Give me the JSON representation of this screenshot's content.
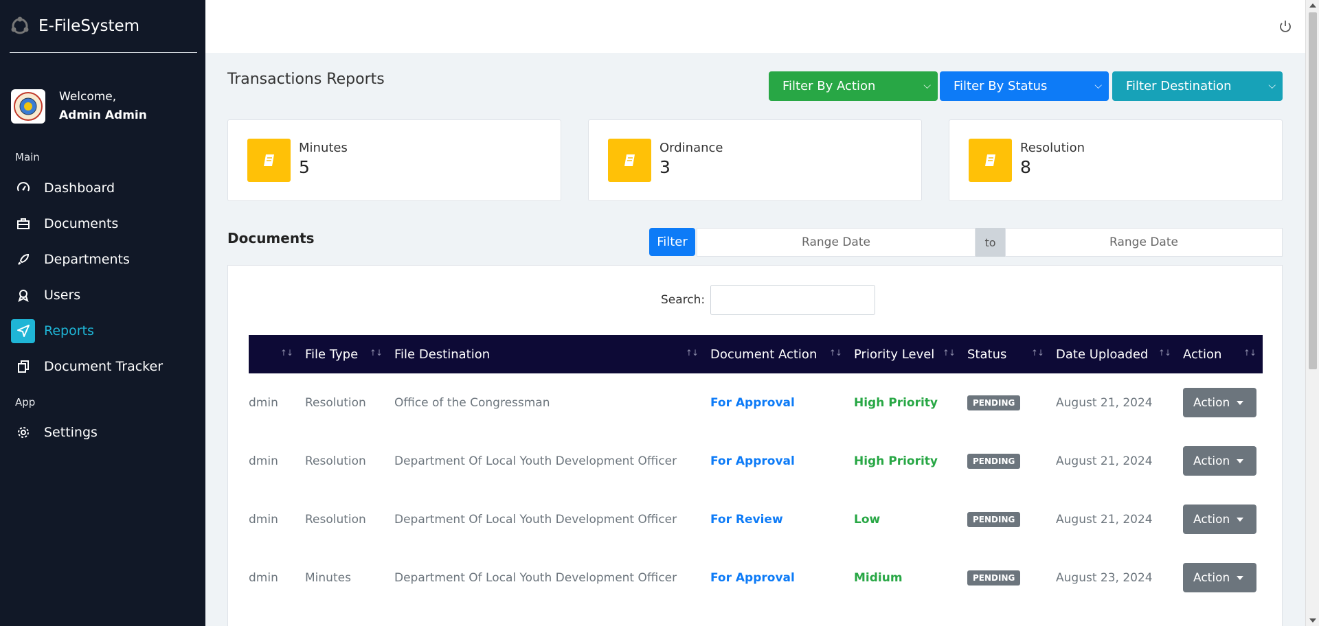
{
  "app": {
    "name": "E-FileSystem"
  },
  "user": {
    "greeting": "Welcome,",
    "name": "Admin Admin"
  },
  "sidebar": {
    "section_main": "Main",
    "section_app": "App",
    "items": [
      {
        "label": "Dashboard",
        "icon": "dashboard-icon"
      },
      {
        "label": "Documents",
        "icon": "briefcase-icon"
      },
      {
        "label": "Departments",
        "icon": "rocket-icon"
      },
      {
        "label": "Users",
        "icon": "award-icon"
      },
      {
        "label": "Reports",
        "icon": "send-icon",
        "active": true
      },
      {
        "label": "Document Tracker",
        "icon": "copy-icon"
      }
    ],
    "app_items": [
      {
        "label": "Settings",
        "icon": "gear-icon"
      }
    ]
  },
  "page": {
    "title": "Transactions Reports",
    "filters": {
      "action": "Filter By Action",
      "status": "Filter By Status",
      "destination": "Filter Destination"
    }
  },
  "stats": [
    {
      "label": "Minutes",
      "value": "5"
    },
    {
      "label": "Ordinance",
      "value": "3"
    },
    {
      "label": "Resolution",
      "value": "8"
    }
  ],
  "documents": {
    "title": "Documents",
    "filter_button": "Filter",
    "date_from_placeholder": "Range Date",
    "to_label": "to",
    "date_to_placeholder": "Range Date",
    "search_label": "Search:",
    "columns": [
      "",
      "File Type",
      "File Destination",
      "Document Action",
      "Priority Level",
      "Status",
      "Date Uploaded",
      "Action"
    ],
    "rows": [
      {
        "owner": "dmin",
        "file_type": "Resolution",
        "destination": "Office of the Congressman",
        "doc_action": "For Approval",
        "priority": "High Priority",
        "status": "PENDING",
        "date": "August 21, 2024",
        "action": "Action"
      },
      {
        "owner": "dmin",
        "file_type": "Resolution",
        "destination": "Department Of Local Youth Development Officer",
        "doc_action": "For Approval",
        "priority": "High Priority",
        "status": "PENDING",
        "date": "August 21, 2024",
        "action": "Action"
      },
      {
        "owner": "dmin",
        "file_type": "Resolution",
        "destination": "Department Of Local Youth Development Officer",
        "doc_action": "For Review",
        "priority": "Low",
        "status": "PENDING",
        "date": "August 21, 2024",
        "action": "Action"
      },
      {
        "owner": "dmin",
        "file_type": "Minutes",
        "destination": "Department Of Local Youth Development Officer",
        "doc_action": "For Approval",
        "priority": "Midium",
        "status": "PENDING",
        "date": "August 23, 2024",
        "action": "Action"
      }
    ]
  },
  "colors": {
    "sidebar_bg": "#111827",
    "active": "#1fb5d6",
    "green": "#28a745",
    "blue": "#0d7bf7",
    "teal": "#17a2b8",
    "yellow": "#ffc107",
    "table_header": "#0d0a36"
  }
}
